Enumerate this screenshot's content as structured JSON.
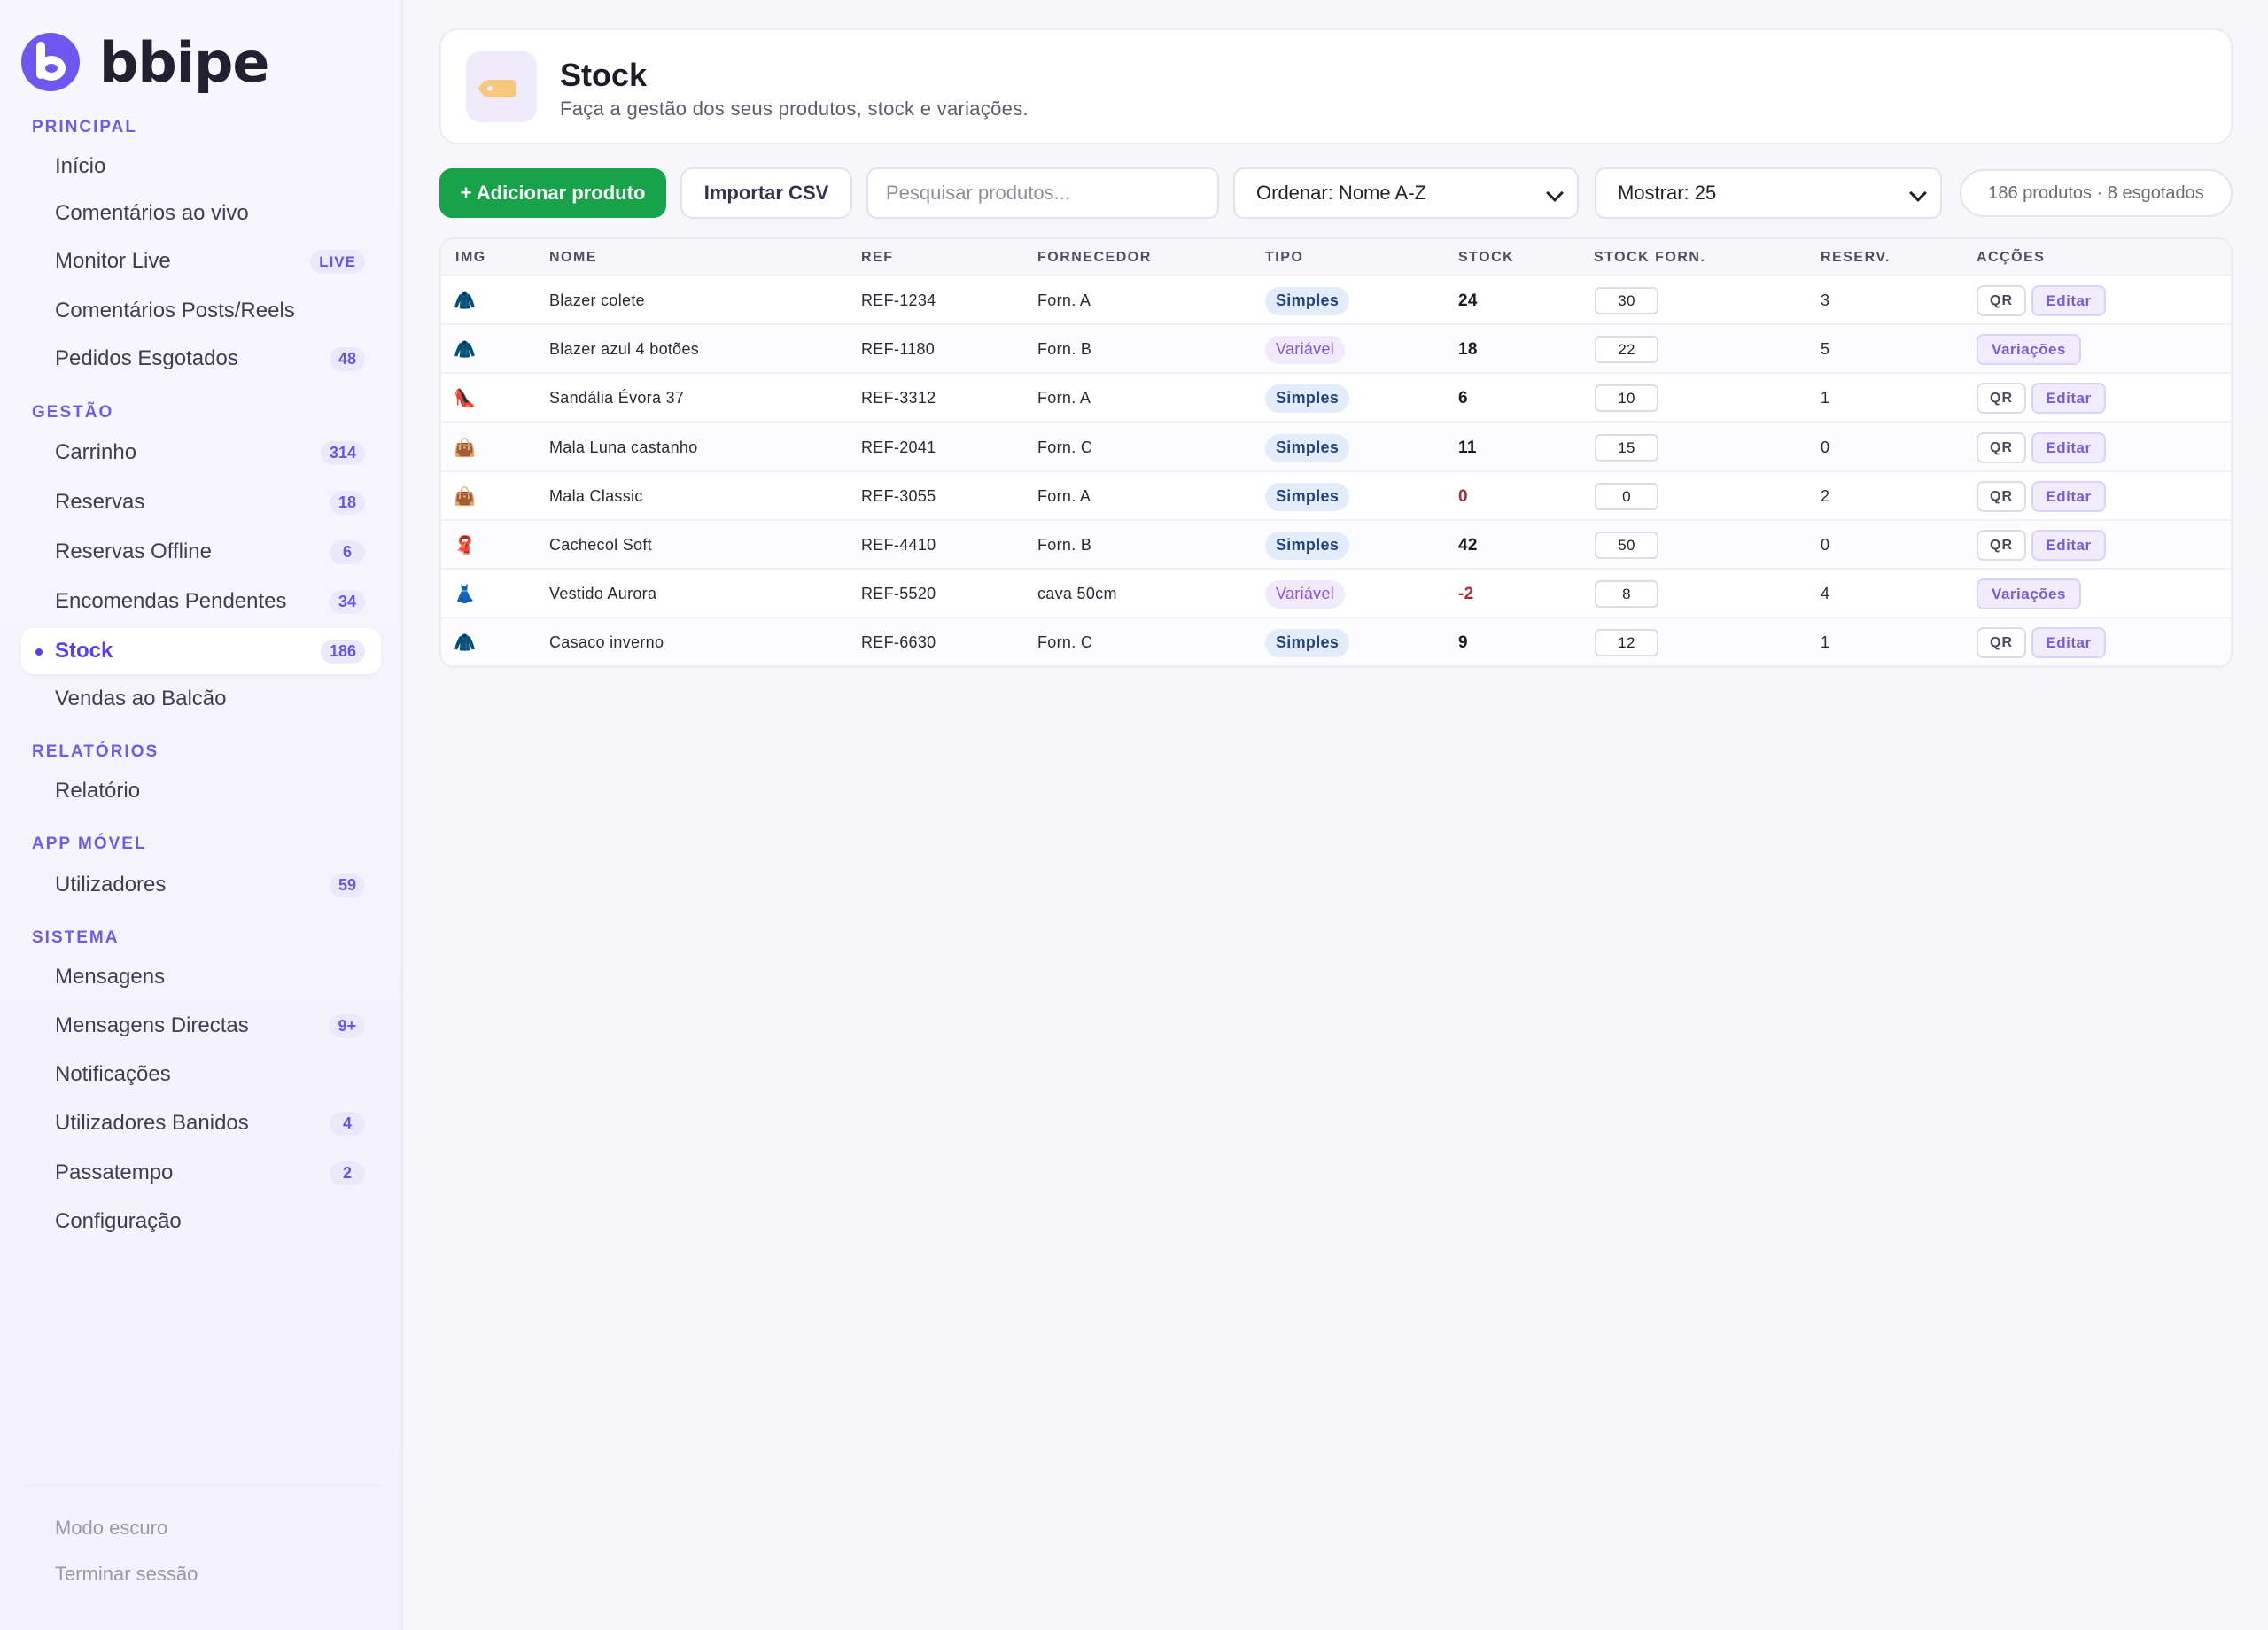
{
  "brand": {
    "name": "bbipe"
  },
  "sidebar": {
    "sections": [
      {
        "label": "PRINCIPAL"
      },
      {
        "label": "GESTÃO"
      },
      {
        "label": "RELATÓRIOS"
      },
      {
        "label": "APP MÓVEL"
      },
      {
        "label": "SISTEMA"
      }
    ],
    "items": [
      {
        "label": "Início"
      },
      {
        "label": "Comentários ao vivo"
      },
      {
        "label": "Monitor Live",
        "badge": "LIVE"
      },
      {
        "label": "Comentários Posts/Reels"
      },
      {
        "label": "Pedidos Esgotados",
        "badge": "48"
      },
      {
        "label": "Carrinho",
        "badge": "314"
      },
      {
        "label": "Reservas",
        "badge": "18"
      },
      {
        "label": "Reservas Offline",
        "badge": "6"
      },
      {
        "label": "Encomendas Pendentes",
        "badge": "34"
      },
      {
        "label": "Stock",
        "badge": "186",
        "active": true
      },
      {
        "label": "Vendas ao Balcão"
      },
      {
        "label": "Relatório"
      },
      {
        "label": "Utilizadores",
        "badge": "59"
      },
      {
        "label": "Mensagens"
      },
      {
        "label": "Mensagens Directas",
        "badge": "9+"
      },
      {
        "label": "Notificações"
      },
      {
        "label": "Utilizadores Banidos",
        "badge": "4"
      },
      {
        "label": "Passatempo",
        "badge": "2"
      },
      {
        "label": "Configuração"
      }
    ],
    "footer": {
      "dark_mode": "Modo escuro",
      "logout": "Terminar sessão"
    }
  },
  "header": {
    "icon": "price-tag-icon",
    "title": "Stock",
    "subtitle": "Faça a gestão dos seus produtos, stock e variações."
  },
  "toolbar": {
    "add_label": "+ Adicionar produto",
    "import_label": "Importar CSV",
    "search_placeholder": "Pesquisar produtos...",
    "sort_value": "Ordenar: Nome A-Z",
    "show_value": "Mostrar: 25",
    "summary": "186 produtos · 8 esgotados"
  },
  "table": {
    "columns": [
      "IMG",
      "NOME",
      "REF",
      "FORNECEDOR",
      "TIPO",
      "STOCK",
      "STOCK FORN.",
      "RESERV.",
      "ACÇÕES"
    ],
    "actions": {
      "qr": "QR",
      "edit": "Editar",
      "variations": "Variações"
    },
    "rows": [
      {
        "icon": "🧥",
        "icon_name": "coat-icon",
        "name": "Blazer colete",
        "ref": "REF-1234",
        "supplier": "Forn. A",
        "type": "Simples",
        "stock": "24",
        "stock_supplier": "30",
        "reserved": "3"
      },
      {
        "icon": "🧥",
        "icon_name": "coat-icon",
        "name": "Blazer azul 4 botões",
        "ref": "REF-1180",
        "supplier": "Forn. B",
        "type": "Variável",
        "stock": "18",
        "stock_supplier": "22",
        "reserved": "5"
      },
      {
        "icon": "👠",
        "icon_name": "high-heel-icon",
        "name": "Sandália Évora 37",
        "ref": "REF-3312",
        "supplier": "Forn. A",
        "type": "Simples",
        "stock": "6",
        "stock_supplier": "10",
        "reserved": "1"
      },
      {
        "icon": "👜",
        "icon_name": "handbag-icon",
        "name": "Mala Luna castanho",
        "ref": "REF-2041",
        "supplier": "Forn. C",
        "type": "Simples",
        "stock": "11",
        "stock_supplier": "15",
        "reserved": "0"
      },
      {
        "icon": "👜",
        "icon_name": "handbag-icon",
        "name": "Mala Classic",
        "ref": "REF-3055",
        "supplier": "Forn. A",
        "type": "Simples",
        "stock": "0",
        "stock_supplier": "0",
        "reserved": "2"
      },
      {
        "icon": "🧣",
        "icon_name": "scarf-icon",
        "name": "Cachecol Soft",
        "ref": "REF-4410",
        "supplier": "Forn. B",
        "type": "Simples",
        "stock": "42",
        "stock_supplier": "50",
        "reserved": "0"
      },
      {
        "icon": "👗",
        "icon_name": "dress-icon",
        "name": "Vestido Aurora",
        "ref": "REF-5520",
        "supplier": "cava 50cm",
        "type": "Variável",
        "stock": "-2",
        "stock_supplier": "8",
        "reserved": "4"
      },
      {
        "icon": "🧥",
        "icon_name": "coat-icon",
        "name": "Casaco inverno",
        "ref": "REF-6630",
        "supplier": "Forn. C",
        "type": "Simples",
        "stock": "9",
        "stock_supplier": "12",
        "reserved": "1"
      }
    ]
  },
  "colors": {
    "accent": "#6d57f0",
    "primary_button": "#18a34a",
    "negative_stock": "#b0283a",
    "simples_pill": "#e2ecfb",
    "variavel_pill": "#f1e9fc"
  }
}
